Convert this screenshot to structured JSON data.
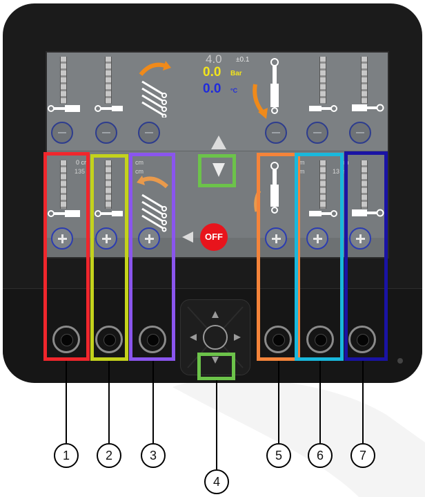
{
  "screen": {
    "top_value": "4.0",
    "tolerance": "±0.1",
    "pressure": "0.0",
    "pressure_unit": "Bar",
    "temperature": "0.0",
    "temperature_unit": "°C",
    "off_label": "OFF",
    "col1_text_a": "0 cr",
    "col1_text_b": "135",
    "col3_text_a": "cm",
    "col3_text_b": "cm",
    "col6_text_a": "m",
    "col6_text_b": "m",
    "col7_text_a": "m",
    "col7_text_b": "13",
    "col7_text_c": "m"
  },
  "callouts": [
    "1",
    "2",
    "3",
    "4",
    "5",
    "6",
    "7"
  ],
  "colors": {
    "pressure": "#f2e41c",
    "temperature": "#1f2bdc",
    "highlight_1": "#f0262c",
    "highlight_2": "#c4d21c",
    "highlight_3": "#8a55ee",
    "highlight_4": "#6cc34a",
    "highlight_5": "#f5843a",
    "highlight_6": "#19b8dc",
    "highlight_7": "#1a13a4"
  },
  "icons": [
    "cylinder-icon",
    "curved-arrow-icon",
    "arrow-up-icon",
    "arrow-down-icon",
    "arrow-left-icon",
    "plus-icon",
    "minus-icon",
    "dpad-icon"
  ]
}
